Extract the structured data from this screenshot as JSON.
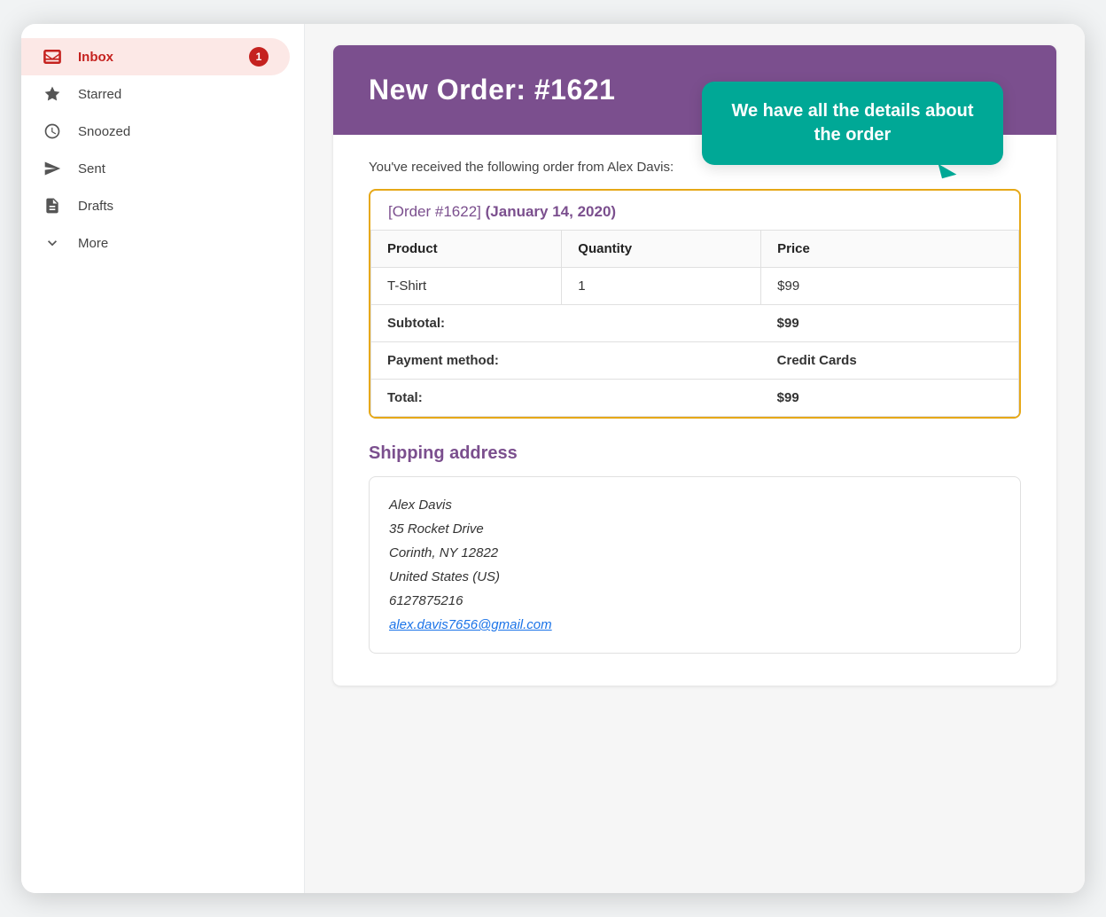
{
  "sidebar": {
    "items": [
      {
        "id": "inbox",
        "label": "Inbox",
        "icon": "inbox-icon",
        "badge": "1",
        "active": true
      },
      {
        "id": "starred",
        "label": "Starred",
        "icon": "star-icon",
        "badge": null,
        "active": false
      },
      {
        "id": "snoozed",
        "label": "Snoozed",
        "icon": "clock-icon",
        "badge": null,
        "active": false
      },
      {
        "id": "sent",
        "label": "Sent",
        "icon": "send-icon",
        "badge": null,
        "active": false
      },
      {
        "id": "drafts",
        "label": "Drafts",
        "icon": "draft-icon",
        "badge": null,
        "active": false
      },
      {
        "id": "more",
        "label": "More",
        "icon": "chevron-down-icon",
        "badge": null,
        "active": false
      }
    ]
  },
  "email": {
    "header_title": "New Order: #1621",
    "tooltip_text": "We have all the details about the order",
    "intro_text": "You've received the following order from Alex Davis:",
    "order_link_label": "[Order #1622]",
    "order_date": "(January 14, 2020)",
    "table": {
      "headers": [
        "Product",
        "Quantity",
        "Price"
      ],
      "rows": [
        {
          "product": "T-Shirt",
          "quantity": "1",
          "price": "$99"
        }
      ],
      "summary": [
        {
          "label": "Subtotal:",
          "value": "$99"
        },
        {
          "label": "Payment method:",
          "value": "Credit Cards"
        },
        {
          "label": "Total:",
          "value": "$99"
        }
      ]
    },
    "shipping_title": "Shipping address",
    "address": {
      "name": "Alex Davis",
      "street": "35 Rocket Drive",
      "city": "Corinth, NY 12822",
      "country": "United States (US)",
      "phone": "6127875216",
      "email": "alex.davis7656@gmail.com"
    }
  },
  "colors": {
    "sidebar_active_bg": "#fce8e6",
    "sidebar_active_text": "#c5221f",
    "email_header_bg": "#7b4f8e",
    "tooltip_bg": "#00a896",
    "order_box_border": "#e6a817",
    "purple_text": "#7b4f8e"
  }
}
